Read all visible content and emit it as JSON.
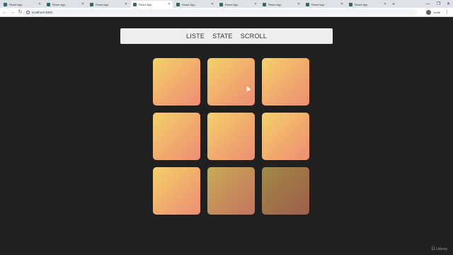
{
  "browser": {
    "tabs": [
      {
        "title": "React App",
        "active": false
      },
      {
        "title": "React App",
        "active": false
      },
      {
        "title": "React App",
        "active": false
      },
      {
        "title": "React App",
        "active": true
      },
      {
        "title": "React App",
        "active": false
      },
      {
        "title": "React App",
        "active": false
      },
      {
        "title": "React App",
        "active": false
      },
      {
        "title": "React App",
        "active": false
      },
      {
        "title": "React App",
        "active": false
      }
    ],
    "new_tab_symbol": "+",
    "url": "localhost:3000",
    "profile_name": "Invité",
    "menu_symbol": "⋮",
    "window_controls": [
      "—",
      "❐",
      "✕"
    ]
  },
  "nav": {
    "links": [
      "LISTE",
      "STATE",
      "SCROLL"
    ]
  },
  "grid": {
    "tiles": 9,
    "tile_colors": [
      "#f3d26a",
      "#ec8f76"
    ]
  },
  "watermark": {
    "text": "Udemy"
  }
}
